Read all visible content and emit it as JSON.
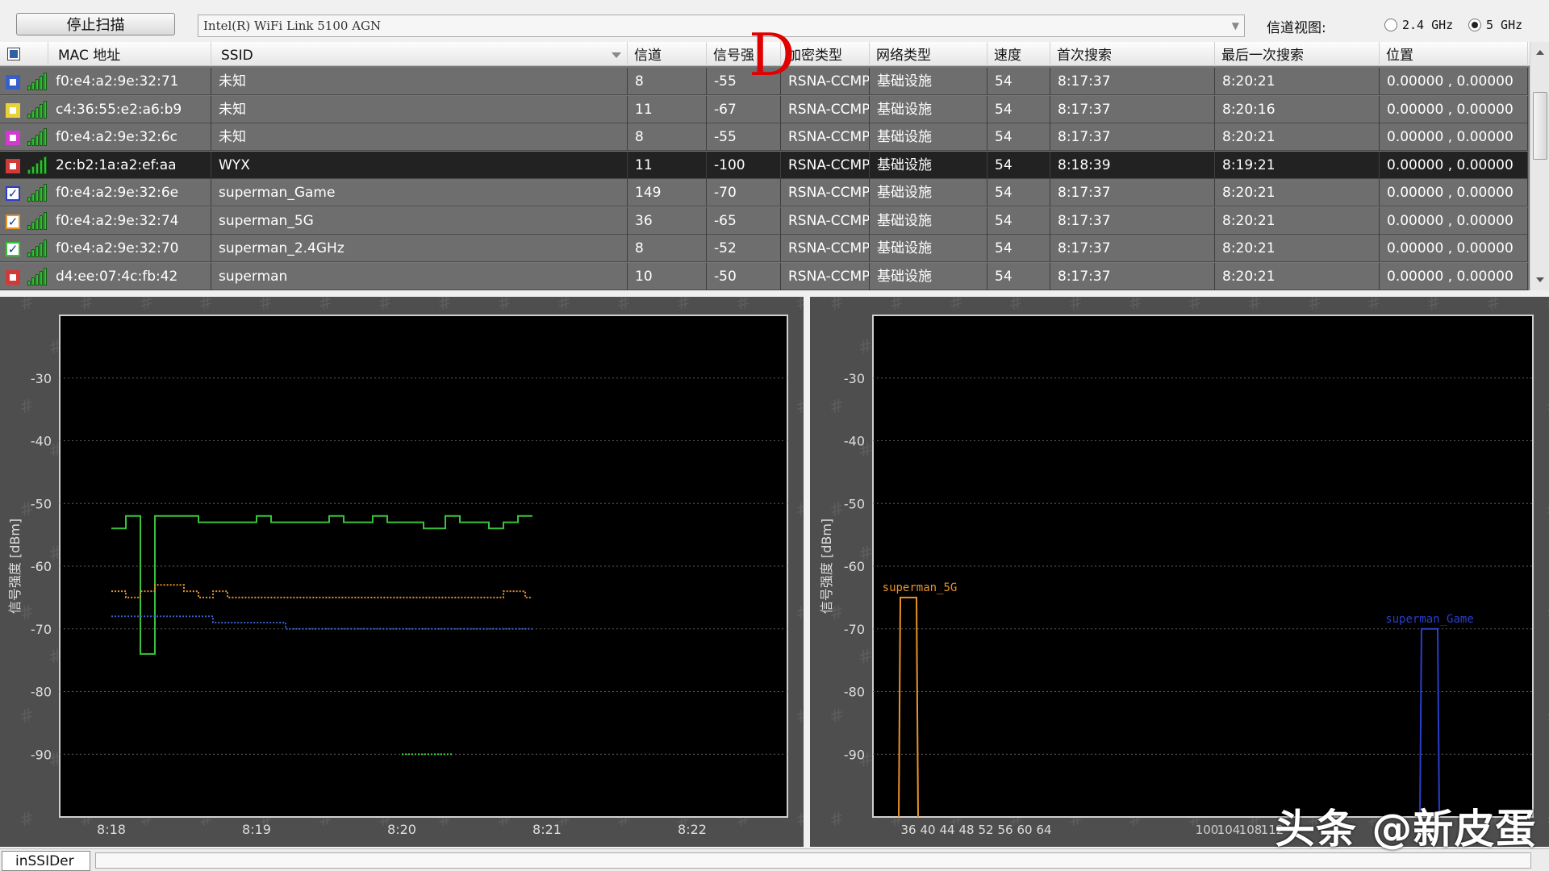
{
  "toolbar": {
    "stop_scan_label": "停止扫描",
    "adapter_value": "Intel(R) WiFi Link 5100 AGN",
    "channel_view_label": "信道视图:",
    "band_24_label": "2.4 GHz",
    "band_5_label": "5 GHz",
    "band_selected": "5 GHz"
  },
  "annotation_letter": "D",
  "columns": [
    "MAC 地址",
    "SSID",
    "信道",
    "信号强",
    "加密类型",
    "网络类型",
    "速度",
    "首次搜索",
    "最后一次搜索",
    "位置"
  ],
  "networks": [
    {
      "mac": "f0:e4:a2:9e:32:71",
      "ssid": "未知",
      "channel": "8",
      "signal": "-55",
      "security": "RSNA-CCMP",
      "network_type": "基础设施",
      "speed": "54",
      "first_seen": "8:17:37",
      "last_seen": "8:20:21",
      "location": "0.00000 , 0.00000",
      "color": "#3a5fcd",
      "checked": false,
      "selected": false
    },
    {
      "mac": "c4:36:55:e2:a6:b9",
      "ssid": "未知",
      "channel": "11",
      "signal": "-67",
      "security": "RSNA-CCMP",
      "network_type": "基础设施",
      "speed": "54",
      "first_seen": "8:17:37",
      "last_seen": "8:20:16",
      "location": "0.00000 , 0.00000",
      "color": "#e8d23a",
      "checked": false,
      "selected": false
    },
    {
      "mac": "f0:e4:a2:9e:32:6c",
      "ssid": "未知",
      "channel": "8",
      "signal": "-55",
      "security": "RSNA-CCMP",
      "network_type": "基础设施",
      "speed": "54",
      "first_seen": "8:17:37",
      "last_seen": "8:20:21",
      "location": "0.00000 , 0.00000",
      "color": "#d23ad2",
      "checked": false,
      "selected": false
    },
    {
      "mac": "2c:b2:1a:a2:ef:aa",
      "ssid": "WYX",
      "channel": "11",
      "signal": "-100",
      "security": "RSNA-CCMP",
      "network_type": "基础设施",
      "speed": "54",
      "first_seen": "8:18:39",
      "last_seen": "8:19:21",
      "location": "0.00000 , 0.00000",
      "color": "#d23a3a",
      "checked": false,
      "selected": true
    },
    {
      "mac": "f0:e4:a2:9e:32:6e",
      "ssid": "superman_Game",
      "channel": "149",
      "signal": "-70",
      "security": "RSNA-CCMP",
      "network_type": "基础设施",
      "speed": "54",
      "first_seen": "8:17:37",
      "last_seen": "8:20:21",
      "location": "0.00000 , 0.00000",
      "color": "#2a3ecd",
      "checked": true,
      "selected": false
    },
    {
      "mac": "f0:e4:a2:9e:32:74",
      "ssid": "superman_5G",
      "channel": "36",
      "signal": "-65",
      "security": "RSNA-CCMP",
      "network_type": "基础设施",
      "speed": "54",
      "first_seen": "8:17:37",
      "last_seen": "8:20:21",
      "location": "0.00000 , 0.00000",
      "color": "#e8922a",
      "checked": true,
      "selected": false
    },
    {
      "mac": "f0:e4:a2:9e:32:70",
      "ssid": "superman_2.4GHz",
      "channel": "8",
      "signal": "-52",
      "security": "RSNA-CCMP",
      "network_type": "基础设施",
      "speed": "54",
      "first_seen": "8:17:37",
      "last_seen": "8:20:21",
      "location": "0.00000 , 0.00000",
      "color": "#3ac23a",
      "checked": true,
      "selected": false
    },
    {
      "mac": "d4:ee:07:4c:fb:42",
      "ssid": "superman",
      "channel": "10",
      "signal": "-50",
      "security": "RSNA-CCMP",
      "network_type": "基础设施",
      "speed": "54",
      "first_seen": "8:17:37",
      "last_seen": "8:20:21",
      "location": "0.00000 , 0.00000",
      "color": "#d23a3a",
      "checked": false,
      "selected": false
    }
  ],
  "chart_data": [
    {
      "type": "line",
      "ylabel": "信号强度 [dBm]",
      "ylim": [
        -100,
        -20
      ],
      "yticks": [
        -30,
        -40,
        -50,
        -60,
        -70,
        -80,
        -90
      ],
      "xticks": [
        "8:18",
        "8:19",
        "8:20",
        "8:21",
        "8:22"
      ],
      "grid": true,
      "series": [
        {
          "color": "#3ac23a",
          "style": "solid",
          "points": [
            [
              0.0,
              -54
            ],
            [
              0.1,
              -54
            ],
            [
              0.1,
              -52
            ],
            [
              0.2,
              -52
            ],
            [
              0.2,
              -74
            ],
            [
              0.3,
              -74
            ],
            [
              0.3,
              -52
            ],
            [
              0.6,
              -52
            ],
            [
              0.6,
              -53
            ],
            [
              1.0,
              -53
            ],
            [
              1.0,
              -52
            ],
            [
              1.1,
              -52
            ],
            [
              1.1,
              -53
            ],
            [
              1.5,
              -53
            ],
            [
              1.5,
              -52
            ],
            [
              1.6,
              -52
            ],
            [
              1.6,
              -53
            ],
            [
              1.8,
              -53
            ],
            [
              1.8,
              -52
            ],
            [
              1.9,
              -52
            ],
            [
              1.9,
              -53
            ],
            [
              2.15,
              -53
            ],
            [
              2.15,
              -54
            ],
            [
              2.3,
              -54
            ],
            [
              2.3,
              -52
            ],
            [
              2.4,
              -52
            ],
            [
              2.4,
              -53
            ],
            [
              2.6,
              -53
            ],
            [
              2.6,
              -54
            ],
            [
              2.7,
              -54
            ],
            [
              2.7,
              -53
            ],
            [
              2.8,
              -53
            ],
            [
              2.8,
              -52
            ],
            [
              2.9,
              -52
            ]
          ]
        },
        {
          "color": "#e8922a",
          "style": "dotted",
          "points": [
            [
              0.0,
              -64
            ],
            [
              0.1,
              -64
            ],
            [
              0.1,
              -65
            ],
            [
              0.2,
              -65
            ],
            [
              0.2,
              -64
            ],
            [
              0.3,
              -64
            ],
            [
              0.3,
              -63
            ],
            [
              0.5,
              -63
            ],
            [
              0.5,
              -64
            ],
            [
              0.6,
              -64
            ],
            [
              0.6,
              -65
            ],
            [
              0.7,
              -65
            ],
            [
              0.7,
              -64
            ],
            [
              0.8,
              -64
            ],
            [
              0.8,
              -65
            ],
            [
              2.7,
              -65
            ],
            [
              2.7,
              -64
            ],
            [
              2.85,
              -64
            ],
            [
              2.85,
              -65
            ],
            [
              2.9,
              -65
            ]
          ]
        },
        {
          "color": "#3a5fcd",
          "style": "dotted",
          "points": [
            [
              0.0,
              -68
            ],
            [
              0.7,
              -68
            ],
            [
              0.7,
              -69
            ],
            [
              1.2,
              -69
            ],
            [
              1.2,
              -70
            ],
            [
              2.9,
              -70
            ]
          ]
        },
        {
          "color": "#3ac23a",
          "style": "dotted",
          "points": [
            [
              2.0,
              -90
            ],
            [
              2.35,
              -90
            ]
          ]
        }
      ]
    },
    {
      "type": "bar",
      "ylabel": "信号强度 [dBm]",
      "ylim": [
        -100,
        -20
      ],
      "yticks": [
        -30,
        -40,
        -50,
        -60,
        -70,
        -80,
        -90
      ],
      "xticks_left": [
        "36",
        "40",
        "44",
        "48",
        "52",
        "56",
        "60",
        "64"
      ],
      "xticks_right": [
        "100",
        "104",
        "108",
        "112"
      ],
      "grid": true,
      "series": [
        {
          "name": "superman_5G",
          "channel": 36,
          "value": -65,
          "color": "#e8922a"
        },
        {
          "name": "superman_Game",
          "channel": 149,
          "value": -70,
          "color": "#2a3ecd"
        }
      ]
    }
  ],
  "status_tab": "inSSIDer",
  "watermark": "头条 @新皮蛋"
}
